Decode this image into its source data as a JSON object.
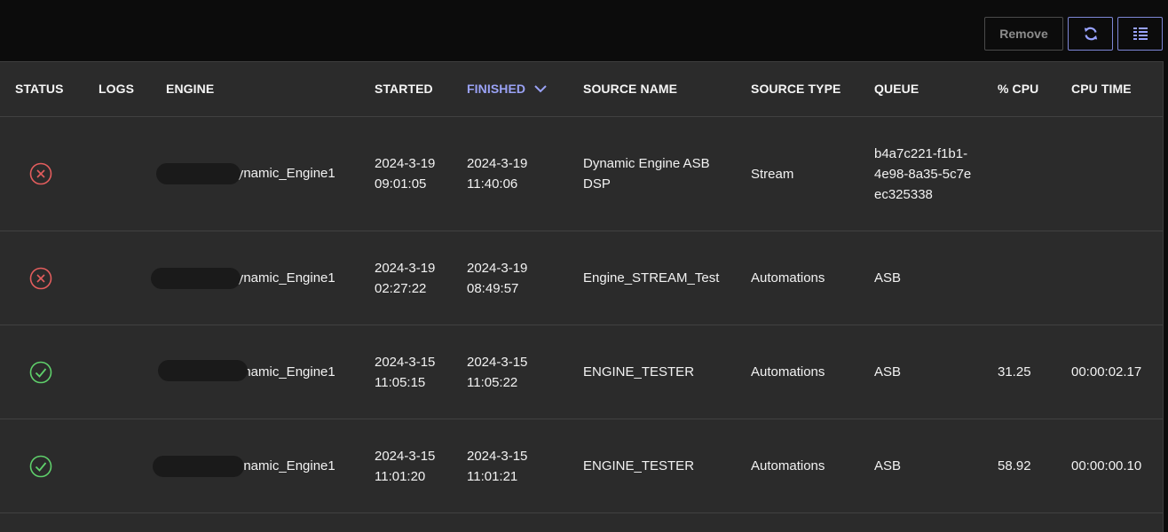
{
  "toolbar": {
    "remove_label": "Remove",
    "refresh_icon": "refresh-icon",
    "columns_icon": "columns-list-icon",
    "accent_color": "#98a2ff"
  },
  "table": {
    "headers": {
      "status": "STATUS",
      "logs": "LOGS",
      "engine": "ENGINE",
      "started": "STARTED",
      "finished": "FINISHED",
      "source_name": "SOURCE NAME",
      "source_type": "SOURCE TYPE",
      "queue": "QUEUE",
      "cpu": "% CPU",
      "cpu_time": "CPU TIME"
    },
    "sorted_column": "finished",
    "sort_direction": "descending",
    "rows": [
      {
        "status": "failed",
        "engine": "Dynamic_Engine1",
        "started": "2024-3-19 09:01:05",
        "finished": "2024-3-19 11:40:06",
        "source_name": "Dynamic Engine ASB DSP",
        "source_type": "Stream",
        "queue": "b4a7c221-f1b1-4e98-8a35-5c7eec325338",
        "cpu": "",
        "cpu_time": ""
      },
      {
        "status": "failed",
        "engine": "Dynamic_Engine1",
        "started": "2024-3-19 02:27:22",
        "finished": "2024-3-19 08:49:57",
        "source_name": "Engine_STREAM_Test",
        "source_type": "Automations",
        "queue": "ASB",
        "cpu": "",
        "cpu_time": ""
      },
      {
        "status": "succeeded",
        "engine": "Dynamic_Engine1",
        "started": "2024-3-15 11:05:15",
        "finished": "2024-3-15 11:05:22",
        "source_name": "ENGINE_TESTER",
        "source_type": "Automations",
        "queue": "ASB",
        "cpu": "31.25",
        "cpu_time": "00:00:02.17"
      },
      {
        "status": "succeeded",
        "engine": "Dynamic_Engine1",
        "started": "2024-3-15 11:01:20",
        "finished": "2024-3-15 11:01:21",
        "source_name": "ENGINE_TESTER",
        "source_type": "Automations",
        "queue": "ASB",
        "cpu": "58.92",
        "cpu_time": "00:00:00.10"
      }
    ]
  },
  "colors": {
    "failed": "#e35d5d",
    "succeeded": "#5fd06b",
    "header_bg": "#0c0c0c",
    "table_bg": "#2b2b2b"
  }
}
